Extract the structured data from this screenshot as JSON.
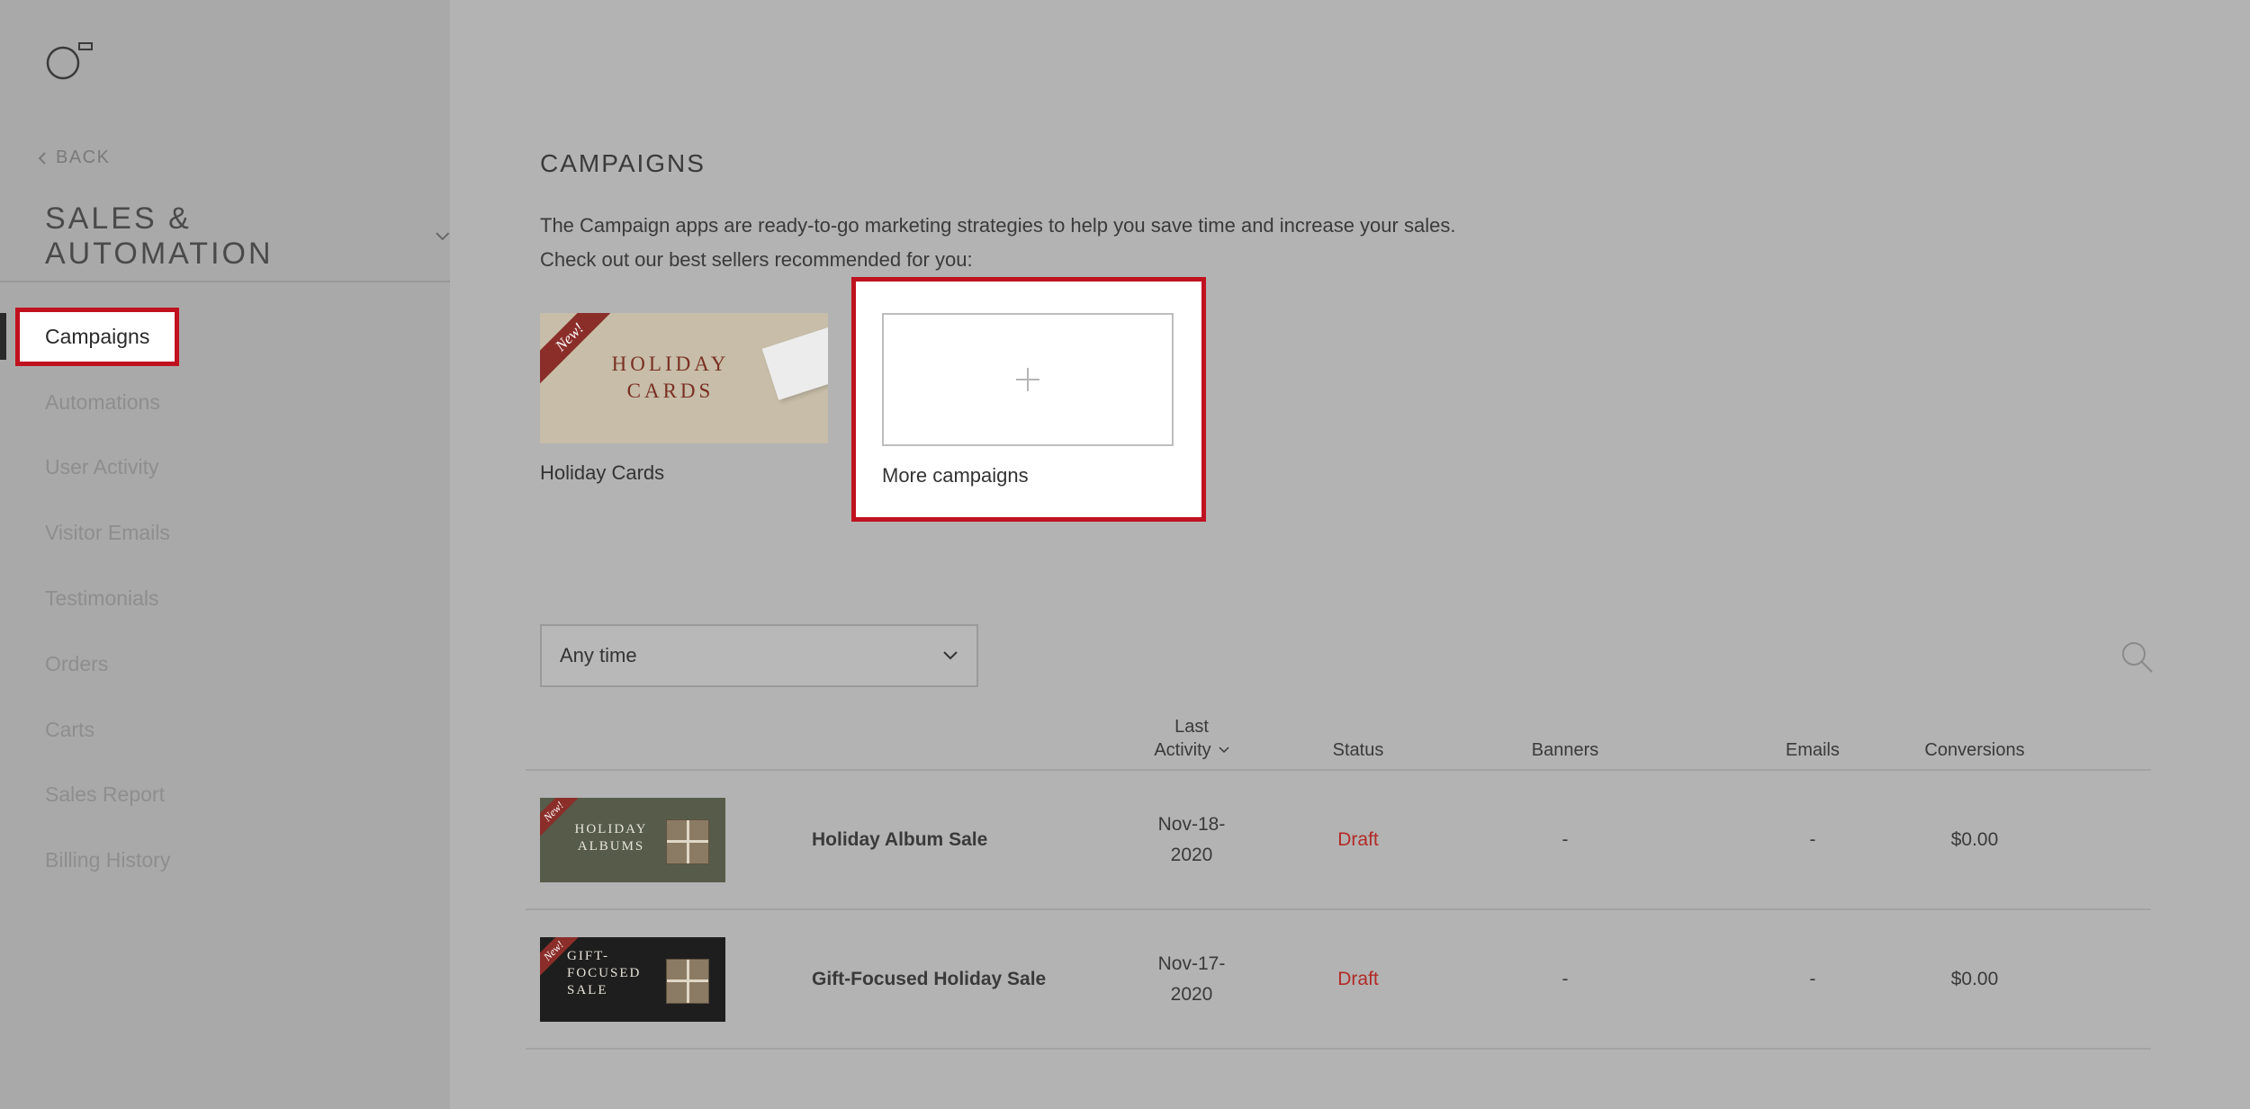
{
  "sidebar": {
    "back_label": "BACK",
    "section_title": "SALES & AUTOMATION",
    "items": [
      {
        "label": "Campaigns",
        "active": true
      },
      {
        "label": "Automations"
      },
      {
        "label": "User Activity"
      },
      {
        "label": "Visitor Emails"
      },
      {
        "label": "Testimonials"
      },
      {
        "label": "Orders"
      },
      {
        "label": "Carts"
      },
      {
        "label": "Sales Report"
      },
      {
        "label": "Billing History"
      }
    ]
  },
  "main": {
    "title": "CAMPAIGNS",
    "intro_line1": "The Campaign apps are ready-to-go marketing strategies to help you save time and increase your sales.",
    "intro_line2": "Check out our best sellers recommended for you:",
    "tiles": [
      {
        "label": "Holiday Cards",
        "image_text_1": "HOLIDAY",
        "image_text_2": "CARDS",
        "ribbon": "New!"
      },
      {
        "label": "More campaigns",
        "icon": "plus-icon"
      }
    ],
    "filter": {
      "value": "Any time"
    },
    "table": {
      "headers": {
        "last_activity_1": "Last",
        "last_activity_2": "Activity",
        "status": "Status",
        "banners": "Banners",
        "emails": "Emails",
        "conversions": "Conversions"
      },
      "rows": [
        {
          "thumb_text_1": "HOLIDAY",
          "thumb_text_2": "ALBUMS",
          "ribbon": "New!",
          "name": "Holiday Album Sale",
          "date_1": "Nov-18-",
          "date_2": "2020",
          "status": "Draft",
          "banners": "-",
          "emails": "-",
          "conversions": "$0.00"
        },
        {
          "thumb_text_1": "GIFT-",
          "thumb_text_2": "FOCUSED",
          "thumb_text_3": "SALE",
          "ribbon": "New!",
          "name": "Gift-Focused Holiday Sale",
          "date_1": "Nov-17-",
          "date_2": "2020",
          "status": "Draft",
          "banners": "-",
          "emails": "-",
          "conversions": "$0.00"
        }
      ]
    }
  },
  "colors": {
    "highlight": "#c0111f",
    "draft": "#b32a27",
    "sidebar_bg": "#a9a9a9",
    "main_bg": "#b3b3b3"
  }
}
